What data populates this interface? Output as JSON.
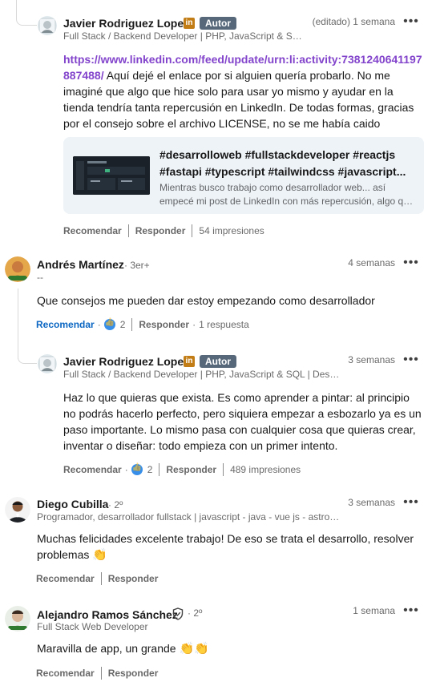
{
  "comments": [
    {
      "author": "Javier Rodriguez Lopez",
      "role_badge": "Autor",
      "subtitle": "Full Stack / Backend Developer | PHP, JavaScript & SQ...",
      "time": "(editado) 1 semana",
      "link": "https://www.linkedin.com/feed/update/urn:li:activity:7381240641197887488/",
      "text": "Aquí dejé el enlace por si alguien quería probarlo. No me imaginé que algo que hice solo para usar yo mismo y ayudar en la tienda tendría tanta repercusión en LinkedIn. De todas formas, gracias por el consejo sobre el archivo LICENSE, no se me había caido",
      "preview": {
        "tags_line1": "#desarrolloweb #fullstackdeveloper #reactjs",
        "tags_line2": "#fastapi #typescript #tailwindcss #javascript...",
        "desc_line1": "Mientras busco trabajo como desarrollador web... así",
        "desc_line2": "empecé mi post de LinkedIn con más repercusión, algo qu..."
      },
      "actions": {
        "react": "Recomendar",
        "reply": "Responder",
        "impressions": "54 impresiones"
      }
    },
    {
      "author": "Andrés Martínez",
      "degree": "· 3er+",
      "subtitle": "--",
      "time": "4 semanas",
      "text": "Que consejos me pueden dar estoy empezando como desarrollador",
      "actions": {
        "react": "Recomendar",
        "likes": "2",
        "reply": "Responder",
        "replies": "1 respuesta"
      }
    },
    {
      "author": "Javier Rodriguez Lopez",
      "role_badge": "Autor",
      "subtitle": "Full Stack / Backend Developer | PHP, JavaScript & SQL | Desarr...",
      "time": "3 semanas",
      "text": "Haz lo que quieras que exista. Es como aprender a pintar: al principio no podrás hacerlo perfecto, pero siquiera empezar a esbozarlo ya es un paso importante. Lo mismo pasa con cualquier cosa que quieras crear, inventar o diseñar: todo empieza con un primer intento.",
      "actions": {
        "react": "Recomendar",
        "likes": "2",
        "reply": "Responder",
        "impressions": "489 impresiones"
      }
    },
    {
      "author": "Diego Cubilla",
      "degree": "· 2º",
      "subtitle": "Programador, desarrollador fullstack | javascript - java - vue js - astro ...",
      "time": "3 semanas",
      "text": "Muchas felicidades excelente trabajo! De eso se trata el desarrollo, resolver problemas",
      "emoji": "👏",
      "actions": {
        "react": "Recomendar",
        "reply": "Responder"
      }
    },
    {
      "author": "Alejandro Ramos Sánchez",
      "degree": "· 2º",
      "subtitle": "Full Stack Web Developer",
      "time": "1 semana",
      "text": "Maravilla de app, un grande",
      "emoji": "👏👏",
      "actions": {
        "react": "Recomendar",
        "reply": "Responder"
      }
    }
  ],
  "in_badge_text": "in",
  "more_icon": "more-horizontal-icon",
  "colors": {
    "link": "#8344cc",
    "accent_blue": "#0a66c2",
    "autor_badge": "#56687a",
    "preview_bg": "#eef3f8"
  }
}
